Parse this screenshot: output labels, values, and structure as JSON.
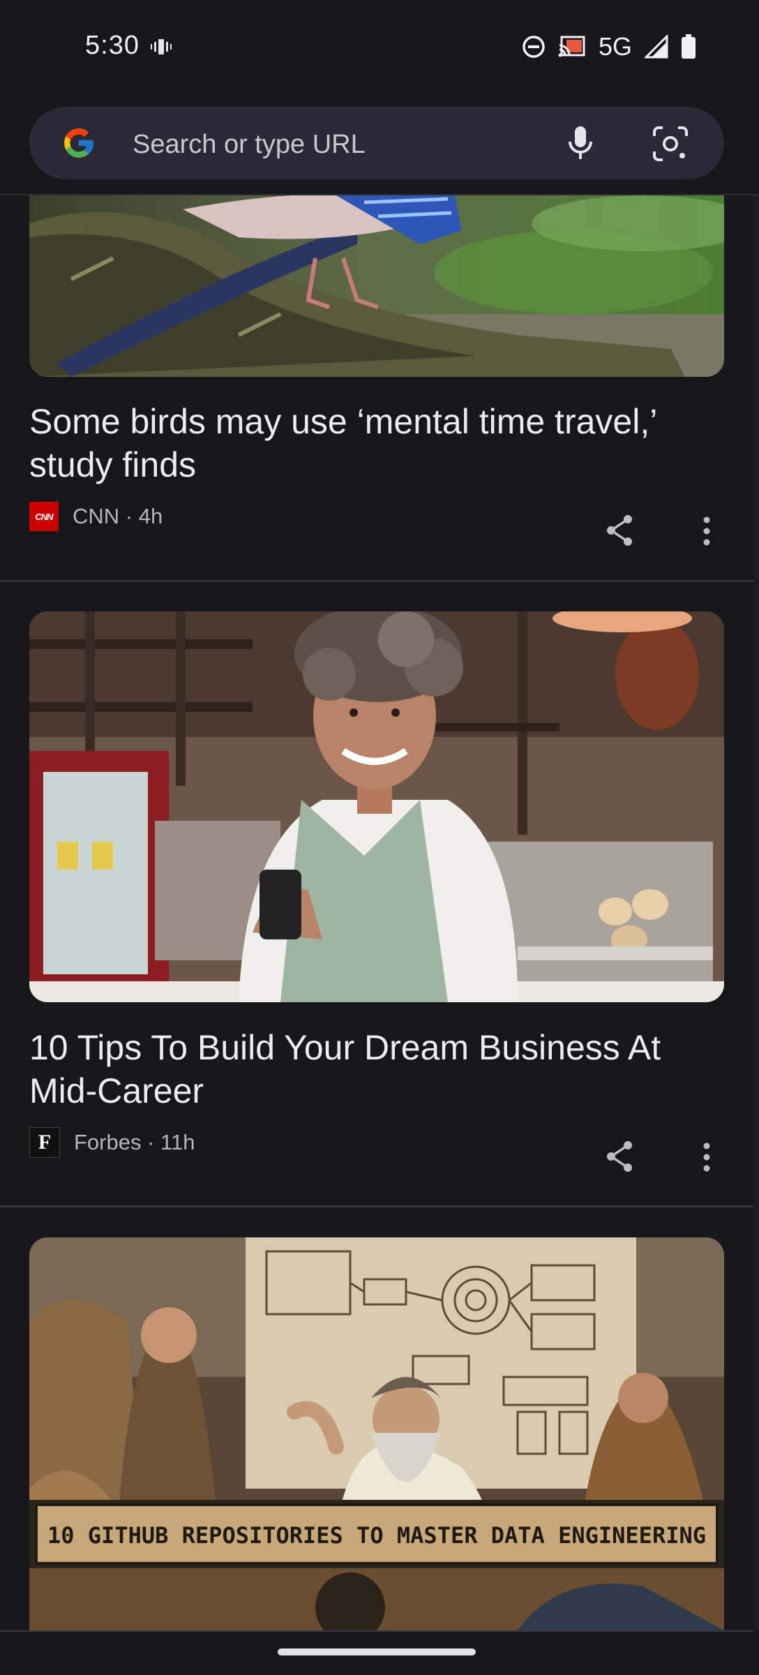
{
  "status_bar": {
    "time": "5:30",
    "network": "5G",
    "icons": [
      "vibrate-icon",
      "do-not-disturb-icon",
      "cast-icon",
      "signal-icon",
      "battery-icon"
    ]
  },
  "search": {
    "placeholder": "Search or type URL",
    "icons": [
      "google-logo",
      "mic-icon",
      "lens-icon"
    ]
  },
  "feed": {
    "cards": [
      {
        "title": "Some birds may use ‘mental time travel,’ study finds",
        "source": "CNN · 4h",
        "logo_text": "CNN",
        "logo_color": "#cc0000",
        "image": "bird-on-mossy-log"
      },
      {
        "title": "10 Tips To Build Your Dream Business At Mid-Career",
        "source": "Forbes · 11h",
        "logo_text": "F",
        "logo_color": "#111111",
        "image": "smiling-woman-in-cafe-with-phone"
      },
      {
        "title": "",
        "image_caption": "10 GITHUB REPOSITORIES TO MASTER DATA ENGINEERING",
        "image": "illustrated-teacher-with-data-diagram"
      }
    ]
  },
  "colors": {
    "background": "#16161b",
    "search_bg": "#2a2935",
    "text_primary": "#ecebf0",
    "text_secondary": "#b7b5bf"
  }
}
